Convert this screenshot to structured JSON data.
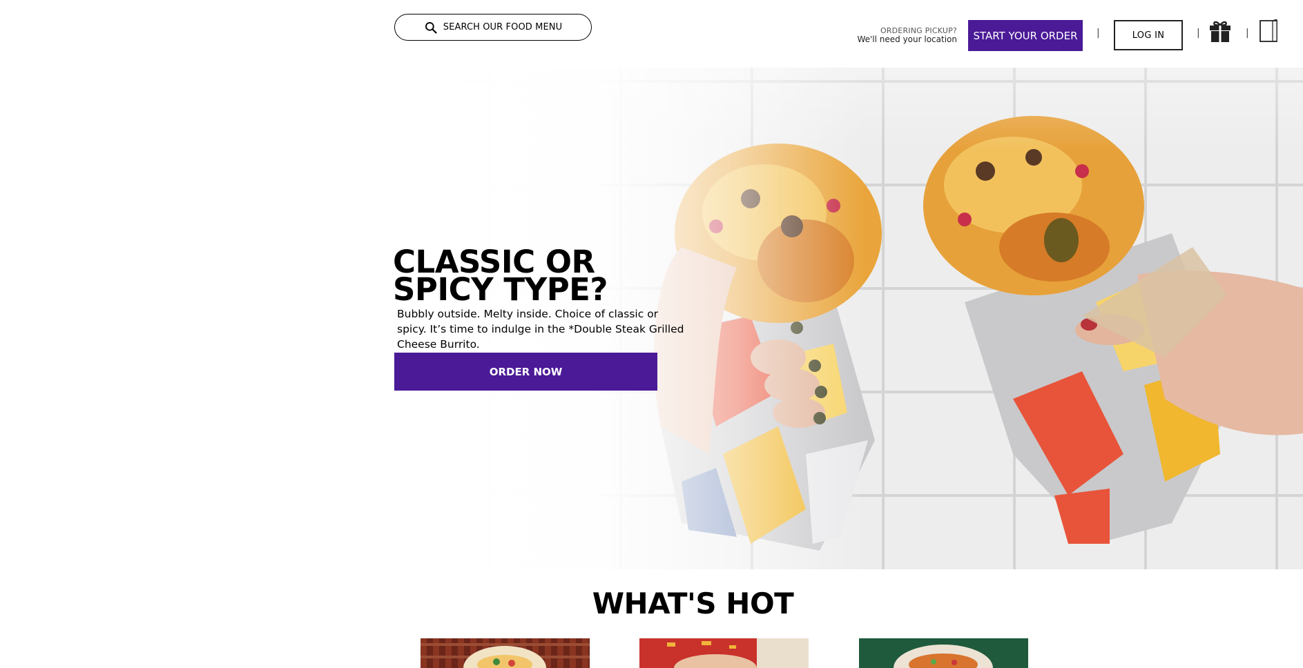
{
  "header": {
    "search_placeholder": "SEARCH OUR FOOD MENU",
    "ordering_mode": "ORDERING PICKUP?",
    "location_prompt": "We'll need your location",
    "start_order_label": "START YOUR ORDER",
    "separator": "|",
    "login_label": "LOG IN",
    "icons": [
      "search-icon",
      "gift-icon",
      "bag-icon"
    ]
  },
  "hero": {
    "title": "CLASSIC OR SPICY TYPE?",
    "description": "Bubbly outside. Melty inside. Choice of classic or spicy. It’s time to indulge in the *Double Steak Grilled Cheese Burrito.",
    "cta_label": "ORDER NOW"
  },
  "whats_hot": {
    "title": "WHAT'S HOT"
  },
  "colors": {
    "brand_purple": "#4a1a97",
    "text": "#000000",
    "background": "#ffffff"
  }
}
